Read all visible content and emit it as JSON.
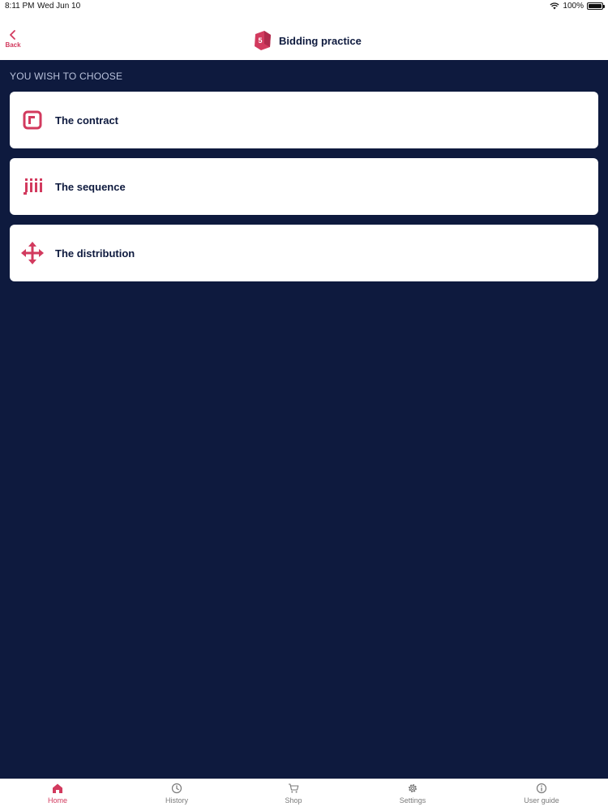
{
  "status_bar": {
    "time": "8:11 PM",
    "date": "Wed Jun 10",
    "battery": "100%"
  },
  "header": {
    "back_label": "Back",
    "title": "Bidding practice",
    "logo_icon": "bidding-logo-icon"
  },
  "section": {
    "label": "YOU WISH TO CHOOSE"
  },
  "options": [
    {
      "label": "The contract",
      "icon": "contract-icon"
    },
    {
      "label": "The sequence",
      "icon": "sequence-icon"
    },
    {
      "label": "The distribution",
      "icon": "distribution-icon"
    }
  ],
  "tabs": [
    {
      "label": "Home",
      "icon": "home-icon",
      "active": true
    },
    {
      "label": "History",
      "icon": "history-icon",
      "active": false
    },
    {
      "label": "Shop",
      "icon": "cart-icon",
      "active": false
    },
    {
      "label": "Settings",
      "icon": "gear-icon",
      "active": false
    },
    {
      "label": "User guide",
      "icon": "info-icon",
      "active": false
    }
  ],
  "colors": {
    "accent": "#d23a5e",
    "background": "#0e1a3e",
    "card": "#ffffff",
    "text_dark": "#0e1a3e",
    "tab_inactive": "#7a7a7a"
  }
}
